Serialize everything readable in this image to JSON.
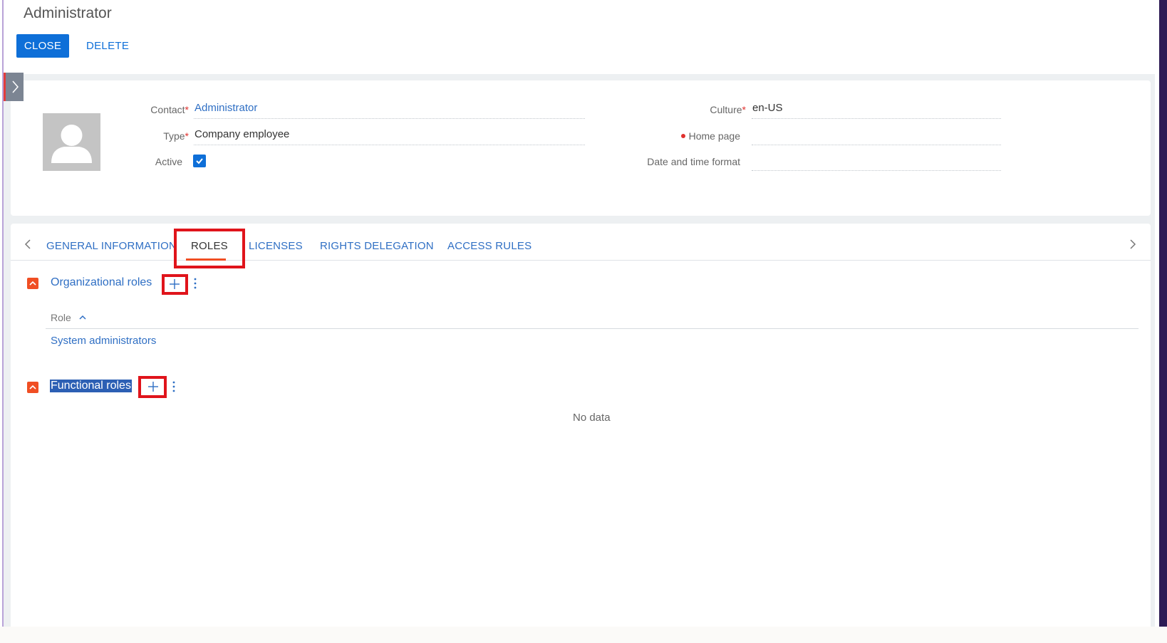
{
  "header": {
    "title": "Administrator",
    "close_label": "CLOSE",
    "delete_label": "DELETE"
  },
  "profile": {
    "contact_label": "Contact",
    "contact_value": "Administrator",
    "type_label": "Type",
    "type_value": "Company employee",
    "active_label": "Active",
    "active_checked": true,
    "culture_label": "Culture",
    "culture_value": "en-US",
    "home_page_label": "Home page",
    "home_page_value": "",
    "date_format_label": "Date and time format",
    "date_format_value": "",
    "required_marker": "*"
  },
  "tabs": [
    {
      "label": "GENERAL INFORMATION",
      "active": false
    },
    {
      "label": "ROLES",
      "active": true
    },
    {
      "label": "LICENSES",
      "active": false
    },
    {
      "label": "RIGHTS DELEGATION",
      "active": false
    },
    {
      "label": "ACCESS RULES",
      "active": false
    }
  ],
  "org_roles": {
    "title": "Organizational roles",
    "column_header": "Role",
    "rows": [
      "System administrators"
    ]
  },
  "functional_roles": {
    "title": "Functional roles",
    "empty_text": "No data"
  },
  "colors": {
    "accent": "#0e6fd8",
    "link": "#2f6fc4",
    "orange": "#f04e23",
    "highlight_red": "#e0141b"
  }
}
